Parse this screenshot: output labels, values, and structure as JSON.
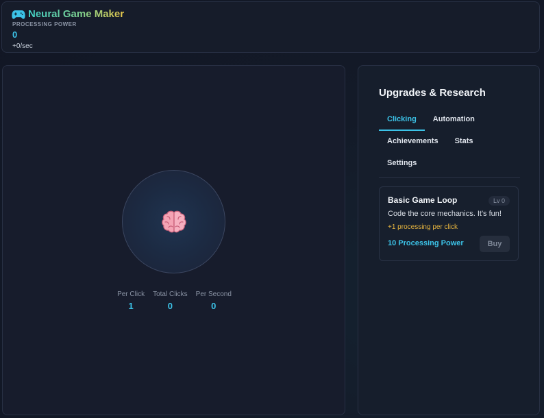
{
  "header": {
    "title": "Neural Game Maker",
    "title_icon": "gamepad-icon",
    "pp_label": "PROCESSING POWER",
    "pp_value": "0",
    "pp_rate": "+0/sec"
  },
  "clicker": {
    "icon": "brain-icon",
    "stats": [
      {
        "label": "Per Click",
        "value": "1"
      },
      {
        "label": "Total Clicks",
        "value": "0"
      },
      {
        "label": "Per Second",
        "value": "0"
      }
    ]
  },
  "upgrades": {
    "title": "Upgrades & Research",
    "tabs": [
      {
        "label": "Clicking",
        "active": true
      },
      {
        "label": "Automation",
        "active": false
      },
      {
        "label": "Achievements",
        "active": false
      },
      {
        "label": "Stats",
        "active": false
      },
      {
        "label": "Settings",
        "active": false
      }
    ],
    "items": [
      {
        "title": "Basic Game Loop",
        "level": "Lv 0",
        "description": "Code the core mechanics. It's fun!",
        "effect": "+1 processing per click",
        "cost": "10 Processing Power",
        "buy_label": "Buy"
      }
    ]
  },
  "colors": {
    "accent": "#3cc3e8",
    "effect": "#e7b53f",
    "background": "#121726"
  }
}
